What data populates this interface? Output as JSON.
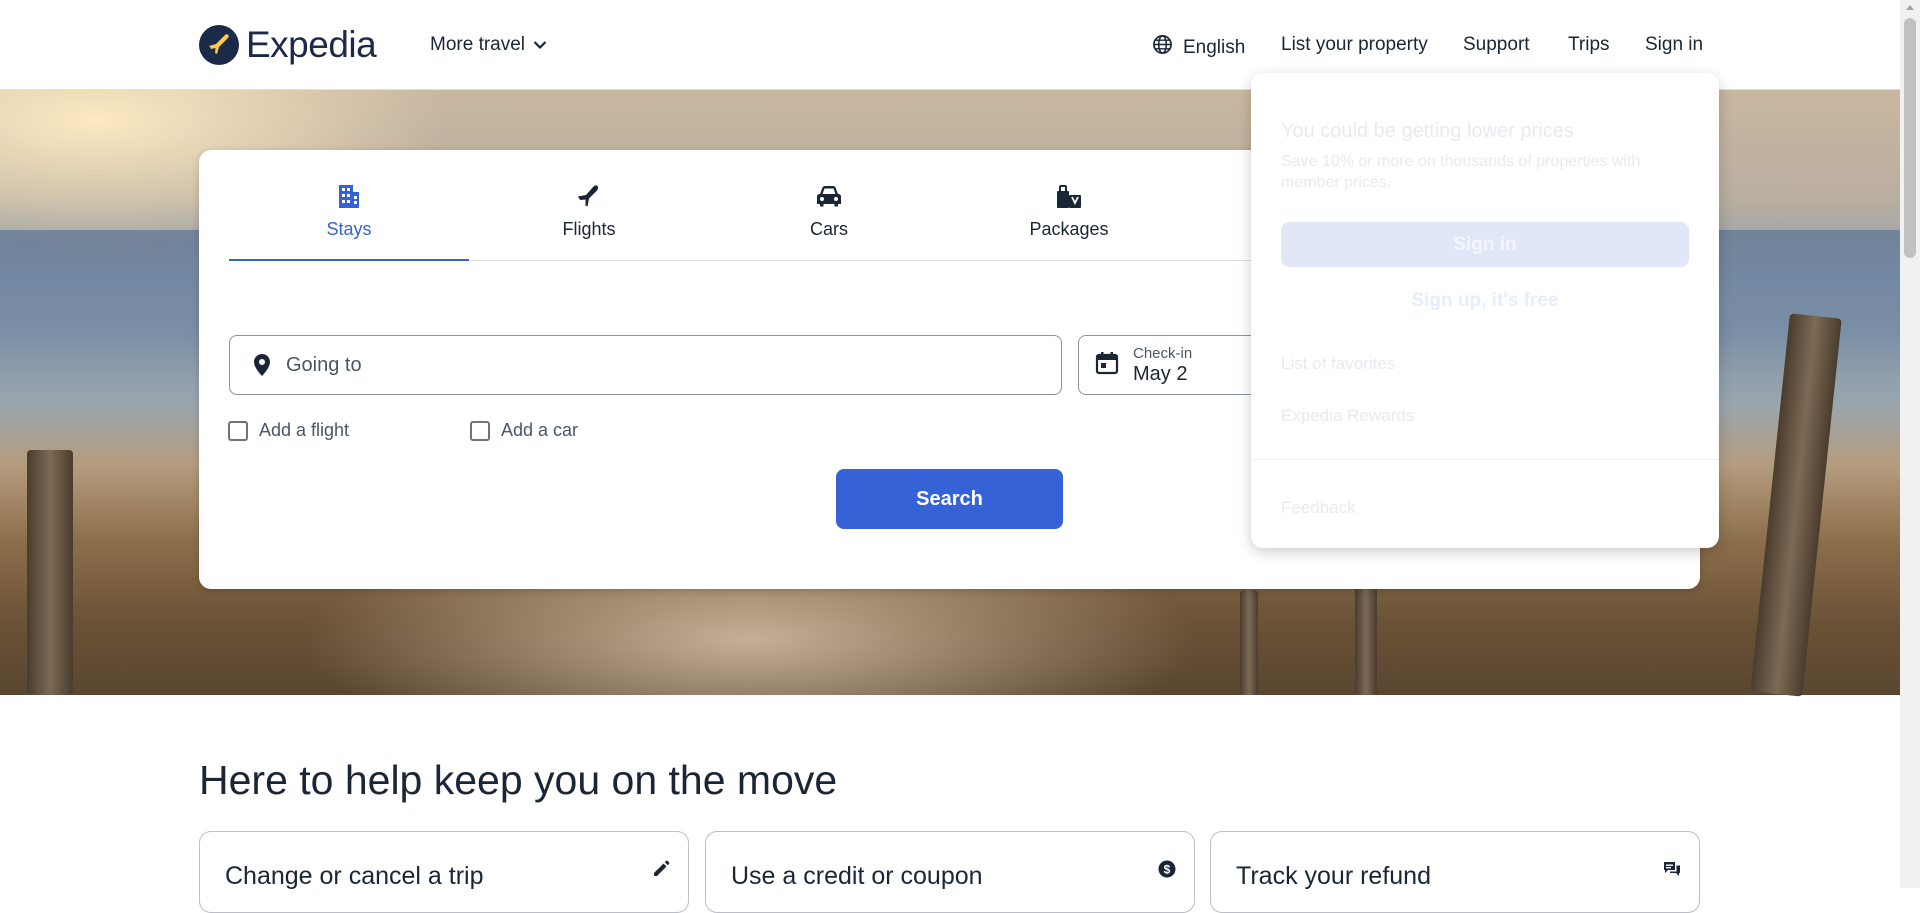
{
  "header": {
    "logo_text": "Expedia",
    "more_travel": "More travel",
    "language": "English",
    "list_property": "List your property",
    "support": "Support",
    "trips": "Trips",
    "sign_in": "Sign in"
  },
  "tabs": [
    {
      "label": "Stays",
      "icon": "building-icon",
      "active": true
    },
    {
      "label": "Flights",
      "icon": "airplane-icon",
      "active": false
    },
    {
      "label": "Cars",
      "icon": "car-icon",
      "active": false
    },
    {
      "label": "Packages",
      "icon": "packages-icon",
      "active": false
    }
  ],
  "search": {
    "going_to_placeholder": "Going to",
    "checkin_label": "Check-in",
    "checkin_value": "May 2",
    "add_flight": "Add a flight",
    "add_car": "Add a car",
    "search_button": "Search"
  },
  "dropdown": {
    "title": "You could be getting lower prices",
    "description": "Save 10% or more on thousands of properties with member prices.",
    "sign_in": "Sign in",
    "sign_up": "Sign up, it's free",
    "favorites": "List of favorites",
    "rewards": "Expedia Rewards",
    "feedback": "Feedback"
  },
  "help": {
    "title": "Here to help keep you on the move",
    "cards": [
      {
        "label": "Change or cancel a trip",
        "icon": "pencil-icon"
      },
      {
        "label": "Use a credit or coupon",
        "icon": "dollar-coin-icon"
      },
      {
        "label": "Track your refund",
        "icon": "chat-bubbles-icon"
      }
    ]
  },
  "colors": {
    "brand_navy": "#1b2a49",
    "accent_blue": "#3662d8",
    "text_primary": "#1a2536"
  }
}
